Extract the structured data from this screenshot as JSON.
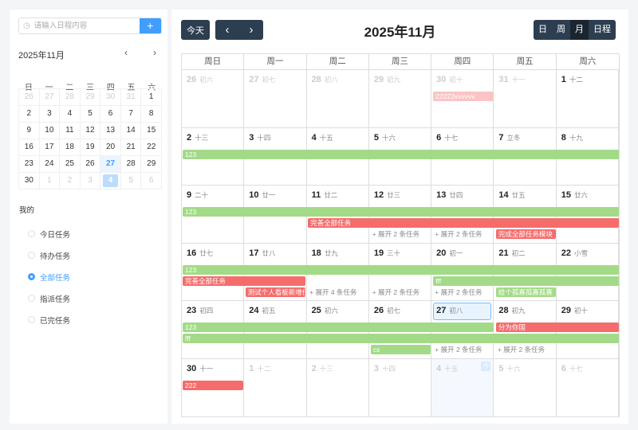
{
  "sidebar": {
    "search_placeholder": "请输入日程内容",
    "search_icon": "clock-icon",
    "add_label": "+",
    "mini_title": "2025年11月",
    "prev": "‹",
    "next": "›",
    "weekdays": [
      "日",
      "一",
      "二",
      "三",
      "四",
      "五",
      "六"
    ],
    "days": [
      {
        "d": "26",
        "o": true
      },
      {
        "d": "27",
        "o": true
      },
      {
        "d": "28",
        "o": true
      },
      {
        "d": "29",
        "o": true
      },
      {
        "d": "30",
        "o": true
      },
      {
        "d": "31",
        "o": true
      },
      {
        "d": "1"
      },
      {
        "d": "2"
      },
      {
        "d": "3"
      },
      {
        "d": "4"
      },
      {
        "d": "5"
      },
      {
        "d": "6"
      },
      {
        "d": "7"
      },
      {
        "d": "8"
      },
      {
        "d": "9"
      },
      {
        "d": "10"
      },
      {
        "d": "11"
      },
      {
        "d": "12"
      },
      {
        "d": "13"
      },
      {
        "d": "14"
      },
      {
        "d": "15"
      },
      {
        "d": "16"
      },
      {
        "d": "17"
      },
      {
        "d": "18"
      },
      {
        "d": "19"
      },
      {
        "d": "20"
      },
      {
        "d": "21"
      },
      {
        "d": "22"
      },
      {
        "d": "23"
      },
      {
        "d": "24"
      },
      {
        "d": "25"
      },
      {
        "d": "26"
      },
      {
        "d": "27",
        "today": true
      },
      {
        "d": "28"
      },
      {
        "d": "29"
      },
      {
        "d": "30"
      },
      {
        "d": "1",
        "o": true
      },
      {
        "d": "2",
        "o": true
      },
      {
        "d": "3",
        "o": true
      },
      {
        "d": "4",
        "o": true,
        "sel": true
      },
      {
        "d": "5",
        "o": true
      },
      {
        "d": "6",
        "o": true
      }
    ],
    "group_label": "我的",
    "filters": [
      {
        "label": "今日任务"
      },
      {
        "label": "待办任务"
      },
      {
        "label": "全部任务",
        "checked": true
      },
      {
        "label": "指派任务"
      },
      {
        "label": "已完任务"
      }
    ]
  },
  "toolbar": {
    "today": "今天",
    "prev": "‹",
    "next": "›",
    "title": "2025年11月",
    "views": [
      {
        "label": "日"
      },
      {
        "label": "周"
      },
      {
        "label": "月",
        "active": true
      },
      {
        "label": "日程"
      }
    ]
  },
  "colors": {
    "green": "#a3da88",
    "red": "#f56c6c",
    "pale_red": "#fbc4c4",
    "accent": "#409eff",
    "dark": "#2c3e50"
  },
  "calendar": {
    "headers": [
      "周日",
      "周一",
      "周二",
      "周三",
      "周四",
      "周五",
      "周六"
    ],
    "days": [
      [
        "26",
        "初六",
        1
      ],
      [
        "27",
        "初七",
        1
      ],
      [
        "28",
        "初八",
        1
      ],
      [
        "29",
        "初九",
        1
      ],
      [
        "30",
        "初十",
        1
      ],
      [
        "31",
        "十一",
        1
      ],
      [
        "1",
        "十二",
        0
      ],
      [
        "2",
        "十三",
        0
      ],
      [
        "3",
        "十四",
        0
      ],
      [
        "4",
        "十五",
        0
      ],
      [
        "5",
        "十六",
        0
      ],
      [
        "6",
        "十七",
        0
      ],
      [
        "7",
        "立冬",
        0
      ],
      [
        "8",
        "十九",
        0
      ],
      [
        "9",
        "二十",
        0
      ],
      [
        "10",
        "廿一",
        0
      ],
      [
        "11",
        "廿二",
        0
      ],
      [
        "12",
        "廿三",
        0
      ],
      [
        "13",
        "廿四",
        0
      ],
      [
        "14",
        "廿五",
        0
      ],
      [
        "15",
        "廿六",
        0
      ],
      [
        "16",
        "廿七",
        0
      ],
      [
        "17",
        "廿八",
        0
      ],
      [
        "18",
        "廿九",
        0
      ],
      [
        "19",
        "三十",
        0
      ],
      [
        "20",
        "初一",
        0
      ],
      [
        "21",
        "初二",
        0
      ],
      [
        "22",
        "小雪",
        0
      ],
      [
        "23",
        "初四",
        0
      ],
      [
        "24",
        "初五",
        0
      ],
      [
        "25",
        "初六",
        0
      ],
      [
        "26",
        "初七",
        0
      ],
      [
        "27",
        "初八",
        0
      ],
      [
        "28",
        "初九",
        0
      ],
      [
        "29",
        "初十",
        0
      ],
      [
        "30",
        "十一",
        0
      ],
      [
        "1",
        "十二",
        1
      ],
      [
        "2",
        "十三",
        1
      ],
      [
        "3",
        "十四",
        1
      ],
      [
        "4",
        "十五",
        1
      ],
      [
        "5",
        "十六",
        1
      ],
      [
        "6",
        "十七",
        1
      ]
    ],
    "today_index": 32,
    "selected_index": 39,
    "today_badge": "今",
    "events": [
      {
        "title": "22222vvvvvv",
        "start": 4,
        "end": 4,
        "color": "pale_red"
      },
      {
        "title": "123",
        "start": 7,
        "end": 32,
        "color": "green"
      },
      {
        "title": "完善全部任务",
        "start": 16,
        "end": 22,
        "color": "red"
      },
      {
        "title": "完成全部任务模块",
        "start": 19,
        "end": 19,
        "color": "red"
      },
      {
        "title": "fff",
        "start": 25,
        "end": 34,
        "color": "green"
      },
      {
        "title": "测试个人看板新增任务",
        "start": 22,
        "end": 22,
        "color": "red"
      },
      {
        "title": "给个孤寡孤寡孤寡",
        "start": 26,
        "end": 26,
        "color": "green"
      },
      {
        "title": "分为你国",
        "start": 33,
        "end": 34,
        "color": "red"
      },
      {
        "title": "cs",
        "start": 31,
        "end": 31,
        "color": "green"
      },
      {
        "title": "222",
        "start": 35,
        "end": 35,
        "color": "red"
      }
    ],
    "more": [
      {
        "day": 17,
        "label": "+ 展开 2 条任务"
      },
      {
        "day": 18,
        "label": "+ 展开 2 条任务"
      },
      {
        "day": 23,
        "label": "+ 展开 4 条任务"
      },
      {
        "day": 24,
        "label": "+ 展开 2 条任务"
      },
      {
        "day": 25,
        "label": "+ 展开 2 条任务"
      },
      {
        "day": 32,
        "label": "+ 展开 2 条任务"
      },
      {
        "day": 33,
        "label": "+ 展开 2 条任务"
      }
    ]
  }
}
